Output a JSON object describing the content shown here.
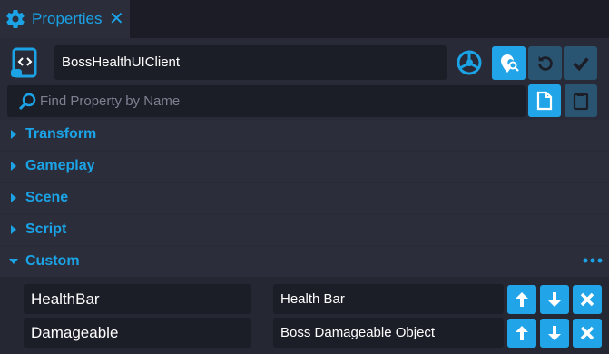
{
  "tab": {
    "title": "Properties",
    "icon": "gear-icon",
    "close_icon": "close-icon"
  },
  "header": {
    "object_name": "BossHealthUIClient",
    "script_icon": "script-icon",
    "network_icon": "networked-icon",
    "buttons": [
      "pin-icon",
      "reset-icon",
      "checkmark-icon"
    ]
  },
  "search": {
    "placeholder": "Find Property by Name",
    "value": ""
  },
  "toolbar_icons": [
    "copy-icon",
    "paste-icon"
  ],
  "sections": [
    {
      "label": "Transform",
      "expanded": false
    },
    {
      "label": "Gameplay",
      "expanded": false
    },
    {
      "label": "Scene",
      "expanded": false
    },
    {
      "label": "Script",
      "expanded": false
    },
    {
      "label": "Custom",
      "expanded": true
    }
  ],
  "custom_properties": [
    {
      "name": "HealthBar",
      "value": "Health Bar"
    },
    {
      "name": "Damageable",
      "value": "Boss Damageable Object"
    }
  ],
  "colors": {
    "accent": "#1ba3e6",
    "panel": "#2b2d3a",
    "field": "#1b1d27",
    "button_active": "#21a5e8",
    "button_inactive": "#2a5572"
  }
}
